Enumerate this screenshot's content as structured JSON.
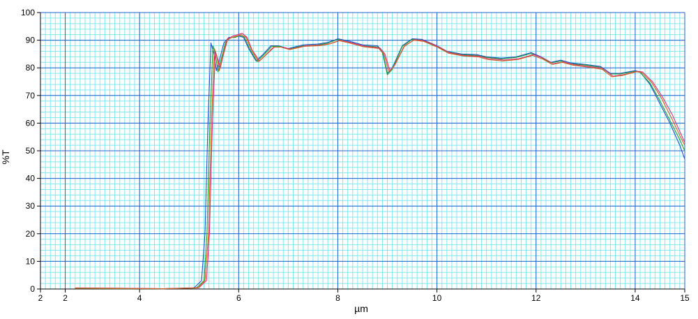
{
  "chart_data": {
    "type": "line",
    "title": "",
    "xlabel": "µm",
    "ylabel": "%T",
    "xlim": [
      2,
      15
    ],
    "ylim": [
      0,
      100
    ],
    "x_tick_labels": [
      {
        "value": 2,
        "label": "2"
      },
      {
        "value": 2.5,
        "label": "2"
      },
      {
        "value": 4,
        "label": "4"
      },
      {
        "value": 6,
        "label": "6"
      },
      {
        "value": 8,
        "label": "8"
      },
      {
        "value": 10,
        "label": "10"
      },
      {
        "value": 12,
        "label": "12"
      },
      {
        "value": 14,
        "label": "14"
      },
      {
        "value": 15,
        "label": "15"
      }
    ],
    "y_ticks": [
      0,
      10,
      20,
      30,
      40,
      50,
      60,
      70,
      80,
      90,
      100
    ],
    "grid": true,
    "legend": "none",
    "colors": {
      "background": "#ffffff",
      "minor_grid": "#7fe8f0",
      "major_grid": "#2060d0",
      "axis": "#000000"
    },
    "series": [
      {
        "color": "#1f4fd0",
        "points": [
          [
            2.7,
            0.3
          ],
          [
            3.5,
            0.2
          ],
          [
            4.5,
            0.1
          ],
          [
            5.1,
            0.4
          ],
          [
            5.25,
            3
          ],
          [
            5.32,
            20
          ],
          [
            5.38,
            60
          ],
          [
            5.44,
            89
          ],
          [
            5.5,
            85
          ],
          [
            5.55,
            79
          ],
          [
            5.6,
            82
          ],
          [
            5.7,
            89
          ],
          [
            5.8,
            91
          ],
          [
            5.9,
            91
          ],
          [
            6.0,
            91.5
          ],
          [
            6.1,
            91
          ],
          [
            6.2,
            87
          ],
          [
            6.35,
            82.5
          ],
          [
            6.5,
            85
          ],
          [
            6.65,
            88
          ],
          [
            6.8,
            88
          ],
          [
            7.0,
            87
          ],
          [
            7.3,
            88.3
          ],
          [
            7.6,
            88.6
          ],
          [
            7.8,
            89.2
          ],
          [
            8.0,
            90.5
          ],
          [
            8.2,
            89.8
          ],
          [
            8.5,
            88.3
          ],
          [
            8.8,
            88
          ],
          [
            8.9,
            86
          ],
          [
            9.0,
            78
          ],
          [
            9.1,
            80
          ],
          [
            9.3,
            88
          ],
          [
            9.5,
            90.5
          ],
          [
            9.7,
            90.3
          ],
          [
            10.0,
            88
          ],
          [
            10.2,
            86
          ],
          [
            10.5,
            85
          ],
          [
            10.8,
            84.8
          ],
          [
            11.0,
            84
          ],
          [
            11.3,
            83.5
          ],
          [
            11.6,
            84
          ],
          [
            11.9,
            85.5
          ],
          [
            12.1,
            84
          ],
          [
            12.3,
            82
          ],
          [
            12.5,
            82.8
          ],
          [
            12.7,
            81.8
          ],
          [
            13.0,
            81.2
          ],
          [
            13.3,
            80.5
          ],
          [
            13.5,
            78
          ],
          [
            13.7,
            78
          ],
          [
            14.0,
            79
          ],
          [
            14.1,
            78.5
          ],
          [
            14.3,
            74
          ],
          [
            14.5,
            67
          ],
          [
            14.7,
            60
          ],
          [
            14.9,
            52
          ],
          [
            15.0,
            47
          ]
        ]
      },
      {
        "color": "#20a030",
        "points": [
          [
            2.7,
            0.2
          ],
          [
            3.5,
            0.1
          ],
          [
            4.5,
            0.1
          ],
          [
            5.15,
            0.4
          ],
          [
            5.3,
            3
          ],
          [
            5.36,
            20
          ],
          [
            5.42,
            60
          ],
          [
            5.48,
            88
          ],
          [
            5.53,
            85
          ],
          [
            5.58,
            78.5
          ],
          [
            5.63,
            82
          ],
          [
            5.73,
            89
          ],
          [
            5.83,
            91
          ],
          [
            5.93,
            91
          ],
          [
            6.02,
            91.8
          ],
          [
            6.12,
            91
          ],
          [
            6.22,
            87
          ],
          [
            6.37,
            82.3
          ],
          [
            6.52,
            85
          ],
          [
            6.67,
            87.8
          ],
          [
            6.82,
            87.8
          ],
          [
            7.0,
            86.8
          ],
          [
            7.3,
            88
          ],
          [
            7.6,
            88.3
          ],
          [
            7.8,
            89
          ],
          [
            8.0,
            90.3
          ],
          [
            8.2,
            89.5
          ],
          [
            8.5,
            88
          ],
          [
            8.8,
            87.6
          ],
          [
            8.9,
            85.5
          ],
          [
            9.0,
            77.5
          ],
          [
            9.1,
            79.5
          ],
          [
            9.3,
            87.8
          ],
          [
            9.5,
            90.3
          ],
          [
            9.7,
            90
          ],
          [
            10.0,
            87.8
          ],
          [
            10.2,
            85.8
          ],
          [
            10.5,
            84.8
          ],
          [
            10.8,
            84.5
          ],
          [
            11.0,
            83.8
          ],
          [
            11.3,
            83.2
          ],
          [
            11.6,
            83.8
          ],
          [
            11.9,
            85.2
          ],
          [
            12.1,
            83.8
          ],
          [
            12.3,
            81.8
          ],
          [
            12.5,
            82.5
          ],
          [
            12.7,
            81.5
          ],
          [
            13.0,
            81
          ],
          [
            13.3,
            80.2
          ],
          [
            13.5,
            77.8
          ],
          [
            13.7,
            77.8
          ],
          [
            14.0,
            78.8
          ],
          [
            14.1,
            78.3
          ],
          [
            14.3,
            74.5
          ],
          [
            14.5,
            68
          ],
          [
            14.7,
            61
          ],
          [
            14.9,
            54
          ],
          [
            15.0,
            50
          ]
        ]
      },
      {
        "color": "#e0307a",
        "points": [
          [
            2.7,
            0.4
          ],
          [
            3.5,
            0.3
          ],
          [
            4.5,
            0.1
          ],
          [
            5.2,
            0.5
          ],
          [
            5.35,
            3
          ],
          [
            5.41,
            20
          ],
          [
            5.47,
            60
          ],
          [
            5.53,
            86
          ],
          [
            5.58,
            83
          ],
          [
            5.63,
            80
          ],
          [
            5.68,
            84
          ],
          [
            5.78,
            90.5
          ],
          [
            5.88,
            91.5
          ],
          [
            5.98,
            92
          ],
          [
            6.07,
            92.5
          ],
          [
            6.17,
            91
          ],
          [
            6.27,
            86.5
          ],
          [
            6.42,
            82.5
          ],
          [
            6.57,
            85
          ],
          [
            6.72,
            87.5
          ],
          [
            6.87,
            87.5
          ],
          [
            7.05,
            86.8
          ],
          [
            7.35,
            88
          ],
          [
            7.65,
            88.2
          ],
          [
            7.85,
            88.8
          ],
          [
            8.05,
            90
          ],
          [
            8.25,
            89.2
          ],
          [
            8.55,
            87.8
          ],
          [
            8.85,
            87.2
          ],
          [
            8.95,
            85
          ],
          [
            9.05,
            79
          ],
          [
            9.15,
            81
          ],
          [
            9.35,
            88
          ],
          [
            9.55,
            90.2
          ],
          [
            9.75,
            89.8
          ],
          [
            10.05,
            87.5
          ],
          [
            10.25,
            85.5
          ],
          [
            10.55,
            84.5
          ],
          [
            10.85,
            84.2
          ],
          [
            11.05,
            83.3
          ],
          [
            11.35,
            82.8
          ],
          [
            11.65,
            83.3
          ],
          [
            11.95,
            84.8
          ],
          [
            12.15,
            83.5
          ],
          [
            12.35,
            81.5
          ],
          [
            12.55,
            82.2
          ],
          [
            12.75,
            81.2
          ],
          [
            13.05,
            80.5
          ],
          [
            13.35,
            79.8
          ],
          [
            13.55,
            77
          ],
          [
            13.75,
            77.5
          ],
          [
            14.05,
            78.8
          ],
          [
            14.15,
            78.5
          ],
          [
            14.35,
            75
          ],
          [
            14.55,
            69.5
          ],
          [
            14.75,
            63
          ],
          [
            14.9,
            57
          ],
          [
            15.0,
            53
          ]
        ]
      },
      {
        "color": "#d06020",
        "points": [
          [
            2.7,
            0.3
          ],
          [
            3.5,
            0.2
          ],
          [
            4.5,
            0.1
          ],
          [
            5.18,
            0.4
          ],
          [
            5.32,
            3
          ],
          [
            5.39,
            20
          ],
          [
            5.45,
            60
          ],
          [
            5.51,
            87
          ],
          [
            5.56,
            84
          ],
          [
            5.61,
            79
          ],
          [
            5.66,
            83
          ],
          [
            5.76,
            90
          ],
          [
            5.86,
            91
          ],
          [
            5.96,
            91.5
          ],
          [
            6.05,
            92
          ],
          [
            6.15,
            91
          ],
          [
            6.25,
            86.8
          ],
          [
            6.4,
            82.2
          ],
          [
            6.55,
            84.8
          ],
          [
            6.7,
            87.5
          ],
          [
            6.85,
            87.5
          ],
          [
            7.03,
            86.6
          ],
          [
            7.33,
            87.8
          ],
          [
            7.63,
            88
          ],
          [
            7.83,
            88.6
          ],
          [
            8.03,
            89.8
          ],
          [
            8.23,
            89
          ],
          [
            8.53,
            87.6
          ],
          [
            8.83,
            87
          ],
          [
            8.93,
            85
          ],
          [
            9.03,
            78.5
          ],
          [
            9.13,
            80.5
          ],
          [
            9.33,
            87.6
          ],
          [
            9.53,
            90
          ],
          [
            9.73,
            89.6
          ],
          [
            10.03,
            87.3
          ],
          [
            10.23,
            85.3
          ],
          [
            10.53,
            84.3
          ],
          [
            10.83,
            84
          ],
          [
            11.03,
            83
          ],
          [
            11.33,
            82.5
          ],
          [
            11.63,
            83
          ],
          [
            11.93,
            84.5
          ],
          [
            12.13,
            83.2
          ],
          [
            12.33,
            81.2
          ],
          [
            12.53,
            82
          ],
          [
            12.73,
            81
          ],
          [
            13.03,
            80.3
          ],
          [
            13.33,
            79.5
          ],
          [
            13.53,
            76.8
          ],
          [
            13.73,
            77.2
          ],
          [
            14.03,
            78.6
          ],
          [
            14.13,
            78.3
          ],
          [
            14.33,
            74.8
          ],
          [
            14.53,
            69
          ],
          [
            14.73,
            62
          ],
          [
            14.9,
            55.5
          ],
          [
            15.0,
            52
          ]
        ]
      }
    ]
  }
}
